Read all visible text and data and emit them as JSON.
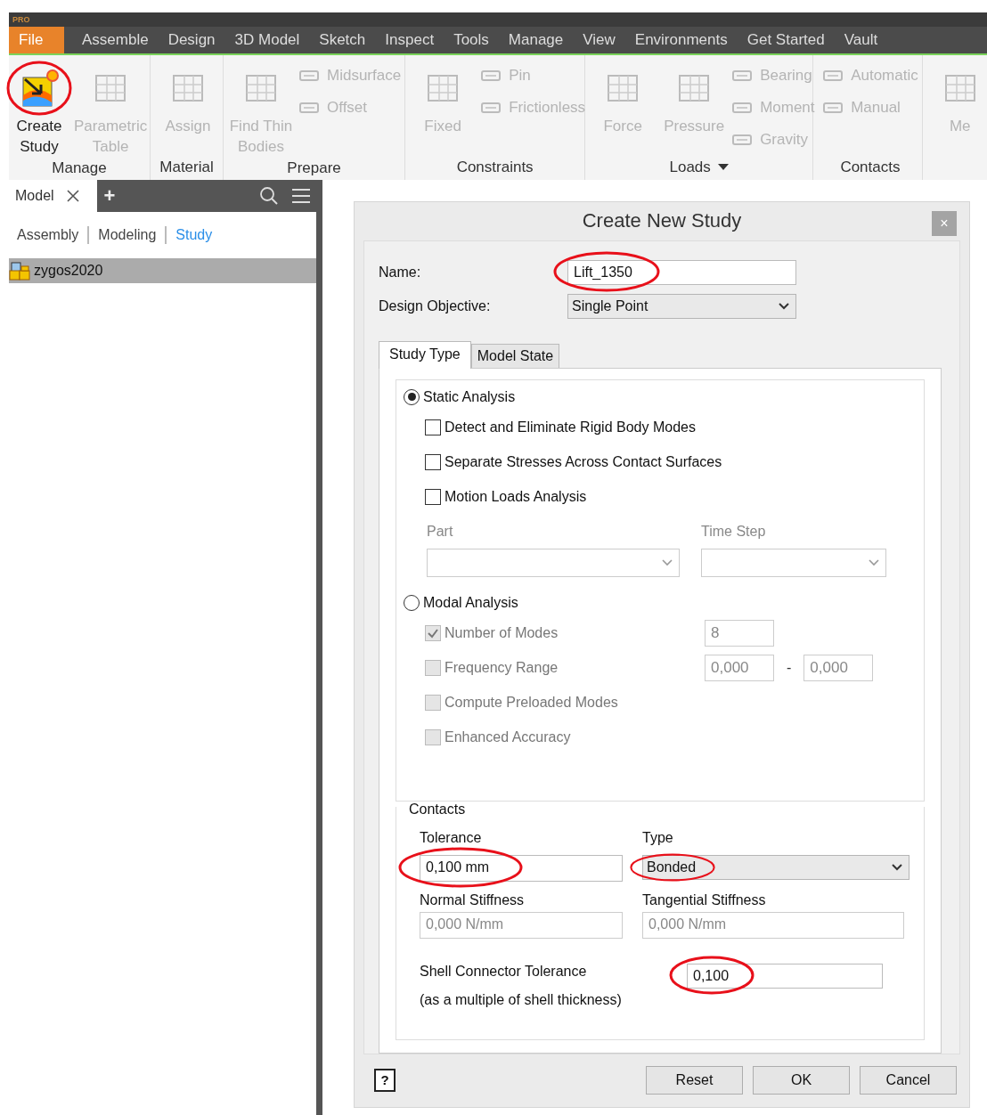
{
  "qat": {
    "badge": "PRO"
  },
  "menu": [
    {
      "label": "File",
      "selected": true
    },
    {
      "label": "Assemble",
      "selected": false
    },
    {
      "label": "Design",
      "selected": false
    },
    {
      "label": "3D Model",
      "selected": false
    },
    {
      "label": "Sketch",
      "selected": false
    },
    {
      "label": "Inspect",
      "selected": false
    },
    {
      "label": "Tools",
      "selected": false
    },
    {
      "label": "Manage",
      "selected": false
    },
    {
      "label": "View",
      "selected": false
    },
    {
      "label": "Environments",
      "selected": false
    },
    {
      "label": "Get Started",
      "selected": false
    },
    {
      "label": "Vault",
      "selected": false
    }
  ],
  "ribbon": {
    "groups": [
      {
        "label": "Manage",
        "large": [
          {
            "label": "Create\nStudy",
            "disabled": false,
            "circled": true
          },
          {
            "label": "Parametric\nTable",
            "disabled": true
          }
        ]
      },
      {
        "label": "Material",
        "large": [
          {
            "label": "Assign",
            "disabled": true
          }
        ]
      },
      {
        "label": "Prepare",
        "large": [
          {
            "label": "Find Thin\nBodies",
            "disabled": true
          }
        ],
        "small": [
          {
            "label": "Midsurface",
            "disabled": true
          },
          {
            "label": "Offset",
            "disabled": true
          }
        ]
      },
      {
        "label": "Constraints",
        "large": [
          {
            "label": "Fixed",
            "disabled": true
          }
        ],
        "small": [
          {
            "label": "Pin",
            "disabled": true
          },
          {
            "label": "Frictionless",
            "disabled": true
          }
        ]
      },
      {
        "label": "Loads",
        "dropdown": true,
        "large": [
          {
            "label": "Force",
            "disabled": true
          },
          {
            "label": "Pressure",
            "disabled": true
          }
        ],
        "small": [
          {
            "label": "Bearing",
            "disabled": true
          },
          {
            "label": "Moment",
            "disabled": true
          },
          {
            "label": "Gravity",
            "disabled": true
          }
        ]
      },
      {
        "label": "Contacts",
        "small": [
          {
            "label": "Automatic",
            "disabled": true
          },
          {
            "label": "Manual",
            "disabled": true
          }
        ]
      },
      {
        "large": [
          {
            "label": "Me",
            "disabled": true
          }
        ]
      }
    ]
  },
  "browser": {
    "tab": "Model",
    "add": "+",
    "filters": [
      {
        "label": "Assembly",
        "selected": false
      },
      {
        "label": "Modeling",
        "selected": false
      },
      {
        "label": "Study",
        "selected": true
      }
    ],
    "tree": [
      {
        "label": "zygos2020",
        "selected": true
      }
    ]
  },
  "dialog": {
    "title": "Create New Study",
    "close": "×",
    "fields": [
      {
        "label": "Name:",
        "value": "Lift_1350",
        "kind": "text",
        "circled": true
      },
      {
        "label": "Design Objective:",
        "value": "Single Point",
        "kind": "select"
      }
    ],
    "tabs": [
      {
        "label": "Study Type",
        "selected": true
      },
      {
        "label": "Model State",
        "selected": false
      }
    ],
    "analyses": [
      {
        "kind": "static",
        "label": "Static Analysis",
        "selected": true,
        "options": [
          {
            "label": "Detect and Eliminate Rigid Body Modes",
            "checked": false,
            "disabled": false
          },
          {
            "label": "Separate Stresses Across Contact Surfaces",
            "checked": false,
            "disabled": false
          },
          {
            "label": "Motion Loads Analysis",
            "checked": false,
            "disabled": false
          }
        ],
        "selectors": [
          {
            "label": "Part",
            "disabled": true
          },
          {
            "label": "Time Step",
            "disabled": true
          }
        ]
      },
      {
        "kind": "modal",
        "label": "Modal Analysis",
        "selected": false,
        "options": [
          {
            "label": "Number of Modes",
            "checked": true,
            "disabled": true,
            "values": [
              "8"
            ]
          },
          {
            "label": "Frequency Range",
            "checked": false,
            "disabled": true,
            "values": [
              "0,000",
              "0,000"
            ],
            "separator": "-"
          },
          {
            "label": "Compute Preloaded Modes",
            "checked": false,
            "disabled": true
          },
          {
            "label": "Enhanced Accuracy",
            "checked": false,
            "disabled": true
          }
        ]
      }
    ],
    "contacts": {
      "title": "Contacts",
      "fields": [
        {
          "label": "Tolerance",
          "value": "0,100 mm",
          "kind": "text",
          "disabled": false,
          "circled": true
        },
        {
          "label": "Type",
          "value": "Bonded",
          "kind": "select",
          "disabled": false,
          "circled": true
        },
        {
          "label": "Normal Stiffness",
          "value": "0,000 N/mm",
          "kind": "text",
          "disabled": true
        },
        {
          "label": "Tangential Stiffness",
          "value": "0,000 N/mm",
          "kind": "text",
          "disabled": true
        }
      ],
      "shell": {
        "label": "Shell Connector Tolerance",
        "note": "(as a multiple of shell thickness)",
        "value": "0,100",
        "circled": true
      }
    },
    "help": "?",
    "buttons": [
      "Reset",
      "OK",
      "Cancel"
    ]
  }
}
